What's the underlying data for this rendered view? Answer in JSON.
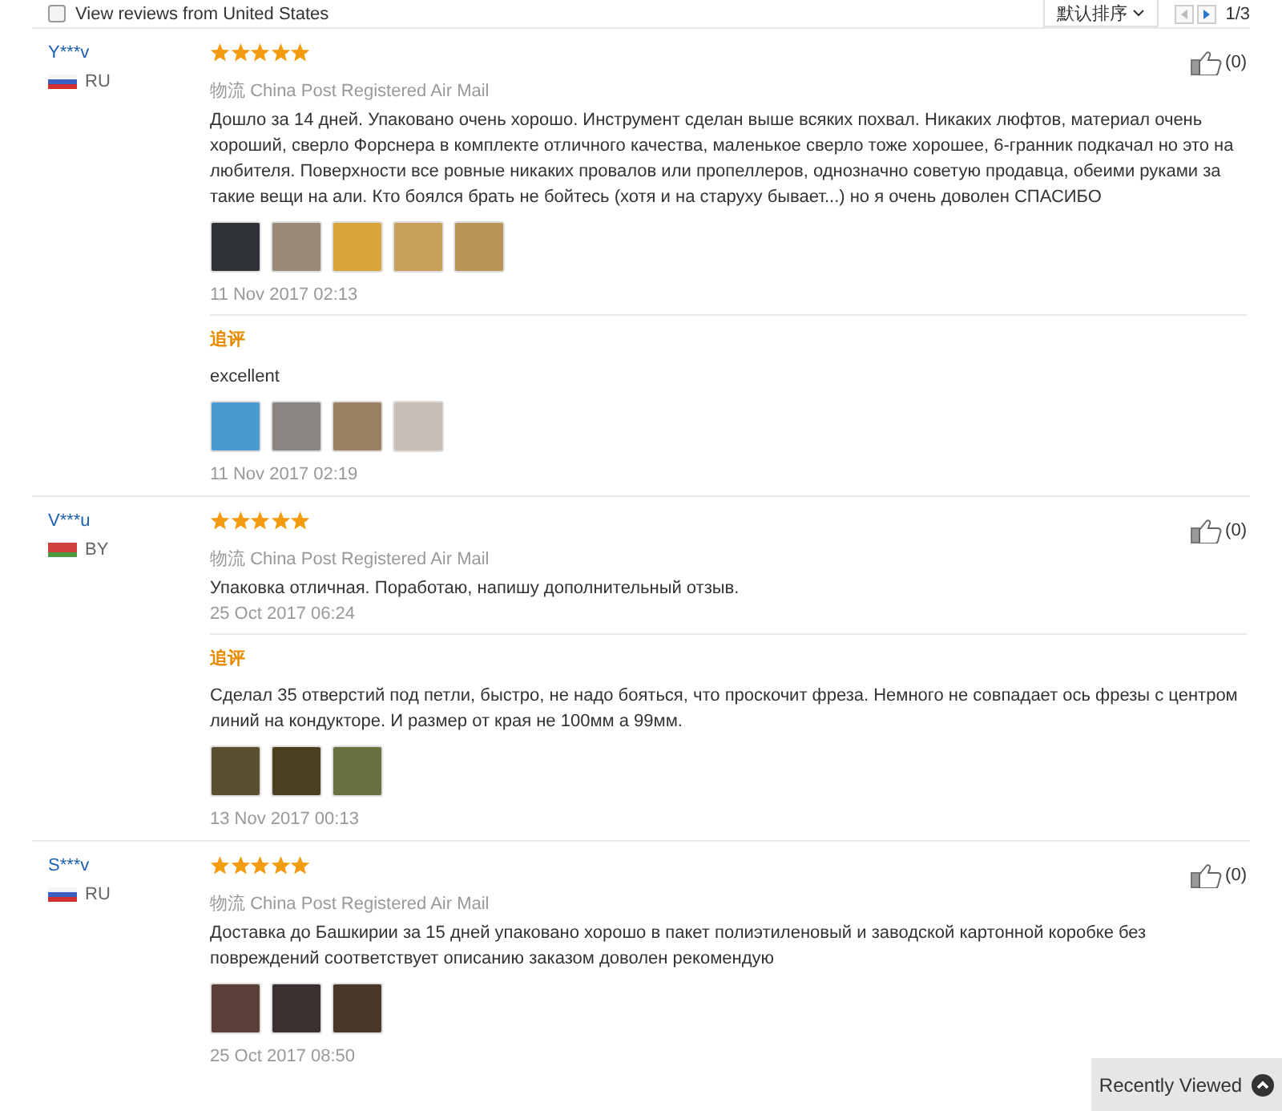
{
  "filter": {
    "label": "View reviews from United States",
    "checked": false
  },
  "sort": {
    "label": "默认排序"
  },
  "pager": {
    "prev_disabled": true,
    "page": "1/3"
  },
  "reviews": [
    {
      "name": "Y***v",
      "flag": {
        "kind": "ru"
      },
      "country": "RU",
      "stars": 5,
      "logistics_label": "物流",
      "logistics": "China Post Registered Air Mail",
      "likes": "(0)",
      "text": "Дошло за 14 дней. Упаковано очень хорошо. Инструмент сделан выше всяких похвал. Никаких люфтов, материал очень хороший, сверло Форснера в комплекте отличного качества, маленькое сверло тоже хорошее, 6-гранник подкачал но это на любителя. Поверхности все ровные никаких провалов или пропеллеров, однозначно советую продавца, обеими руками за такие вещи на али. Кто боялся брать не бойтесь (хотя и на старуху бывает...) но я очень доволен СПАСИБО",
      "photos": [
        {
          "color": "#2e3236"
        },
        {
          "color": "#9a8a78"
        },
        {
          "color": "#d9a53a"
        },
        {
          "color": "#c9a05a"
        },
        {
          "color": "#b89456"
        }
      ],
      "date": "11 Nov 2017 02:13",
      "followup": {
        "label": "追评",
        "text": "excellent",
        "photos": [
          {
            "color": "#4a9ad0"
          },
          {
            "color": "#8a8580"
          },
          {
            "color": "#9a8060"
          },
          {
            "color": "#c8c0b8"
          }
        ],
        "date": "11 Nov 2017 02:19"
      }
    },
    {
      "name": "V***u",
      "flag": {
        "kind": "by"
      },
      "country": "BY",
      "stars": 5,
      "logistics_label": "物流",
      "logistics": "China Post Registered Air Mail",
      "likes": "(0)",
      "text": "Упаковка отличная. Поработаю, напишу дополнительный отзыв.",
      "date": "25 Oct 2017 06:24",
      "followup": {
        "label": "追评",
        "text": "Сделал 35 отверстий под петли, быстро, не надо бояться, что проскочит фреза. Немного не совпадает ось фрезы с центром линий на кондукторе. И размер от края не 100мм а 99мм.",
        "photos": [
          {
            "color": "#5a5030"
          },
          {
            "color": "#4a4020"
          },
          {
            "color": "#6a7040"
          }
        ],
        "date": "13 Nov 2017 00:13"
      }
    },
    {
      "name": "S***v",
      "flag": {
        "kind": "ru"
      },
      "country": "RU",
      "stars": 5,
      "logistics_label": "物流",
      "logistics": "China Post Registered Air Mail",
      "likes": "(0)",
      "text": "Доставка до Башкирии за 15 дней упаковано хорошо в пакет полиэтиленовый и заводской картонной коробке без повреждений соответствует описанию заказом доволен рекомендую",
      "photos": [
        {
          "color": "#5a4038"
        },
        {
          "color": "#3a3030"
        },
        {
          "color": "#4a3828"
        }
      ],
      "date": "25 Oct 2017 08:50"
    }
  ],
  "recently_viewed": {
    "label": "Recently Viewed"
  }
}
